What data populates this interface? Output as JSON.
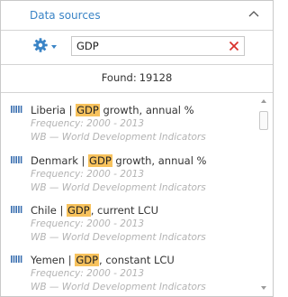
{
  "header": {
    "title": "Data sources",
    "collapse_icon": "chevron-up-icon"
  },
  "toolbar": {
    "settings_icon": "gear-icon",
    "search": {
      "value": "GDP",
      "placeholder": ""
    },
    "clear_icon": "close-icon"
  },
  "results": {
    "found_label": "Found:",
    "found_count": "19128"
  },
  "items": [
    {
      "before": "Liberia | ",
      "match": "GDP",
      "after": " growth, annual %",
      "frequency": "Frequency: 2000 - 2013",
      "source": "WB — World Development Indicators",
      "icon": "indicator-icon"
    },
    {
      "before": "Denmark | ",
      "match": "GDP",
      "after": " growth, annual %",
      "frequency": "Frequency: 2000 - 2013",
      "source": "WB — World Development Indicators",
      "icon": "indicator-icon"
    },
    {
      "before": "Chile | ",
      "match": "GDP",
      "after": ", current LCU",
      "frequency": "Frequency: 2000 - 2013",
      "source": "WB — World Development Indicators",
      "icon": "indicator-icon"
    },
    {
      "before": "Yemen | ",
      "match": "GDP",
      "after": ", constant LCU",
      "frequency": "Frequency: 2000 - 2013",
      "source": "WB — World Development Indicators",
      "icon": "indicator-icon"
    }
  ],
  "colors": {
    "accent": "#3a84c6",
    "highlight": "#f7c25d",
    "clear": "#d9322b",
    "muted": "#b3b3b3"
  }
}
